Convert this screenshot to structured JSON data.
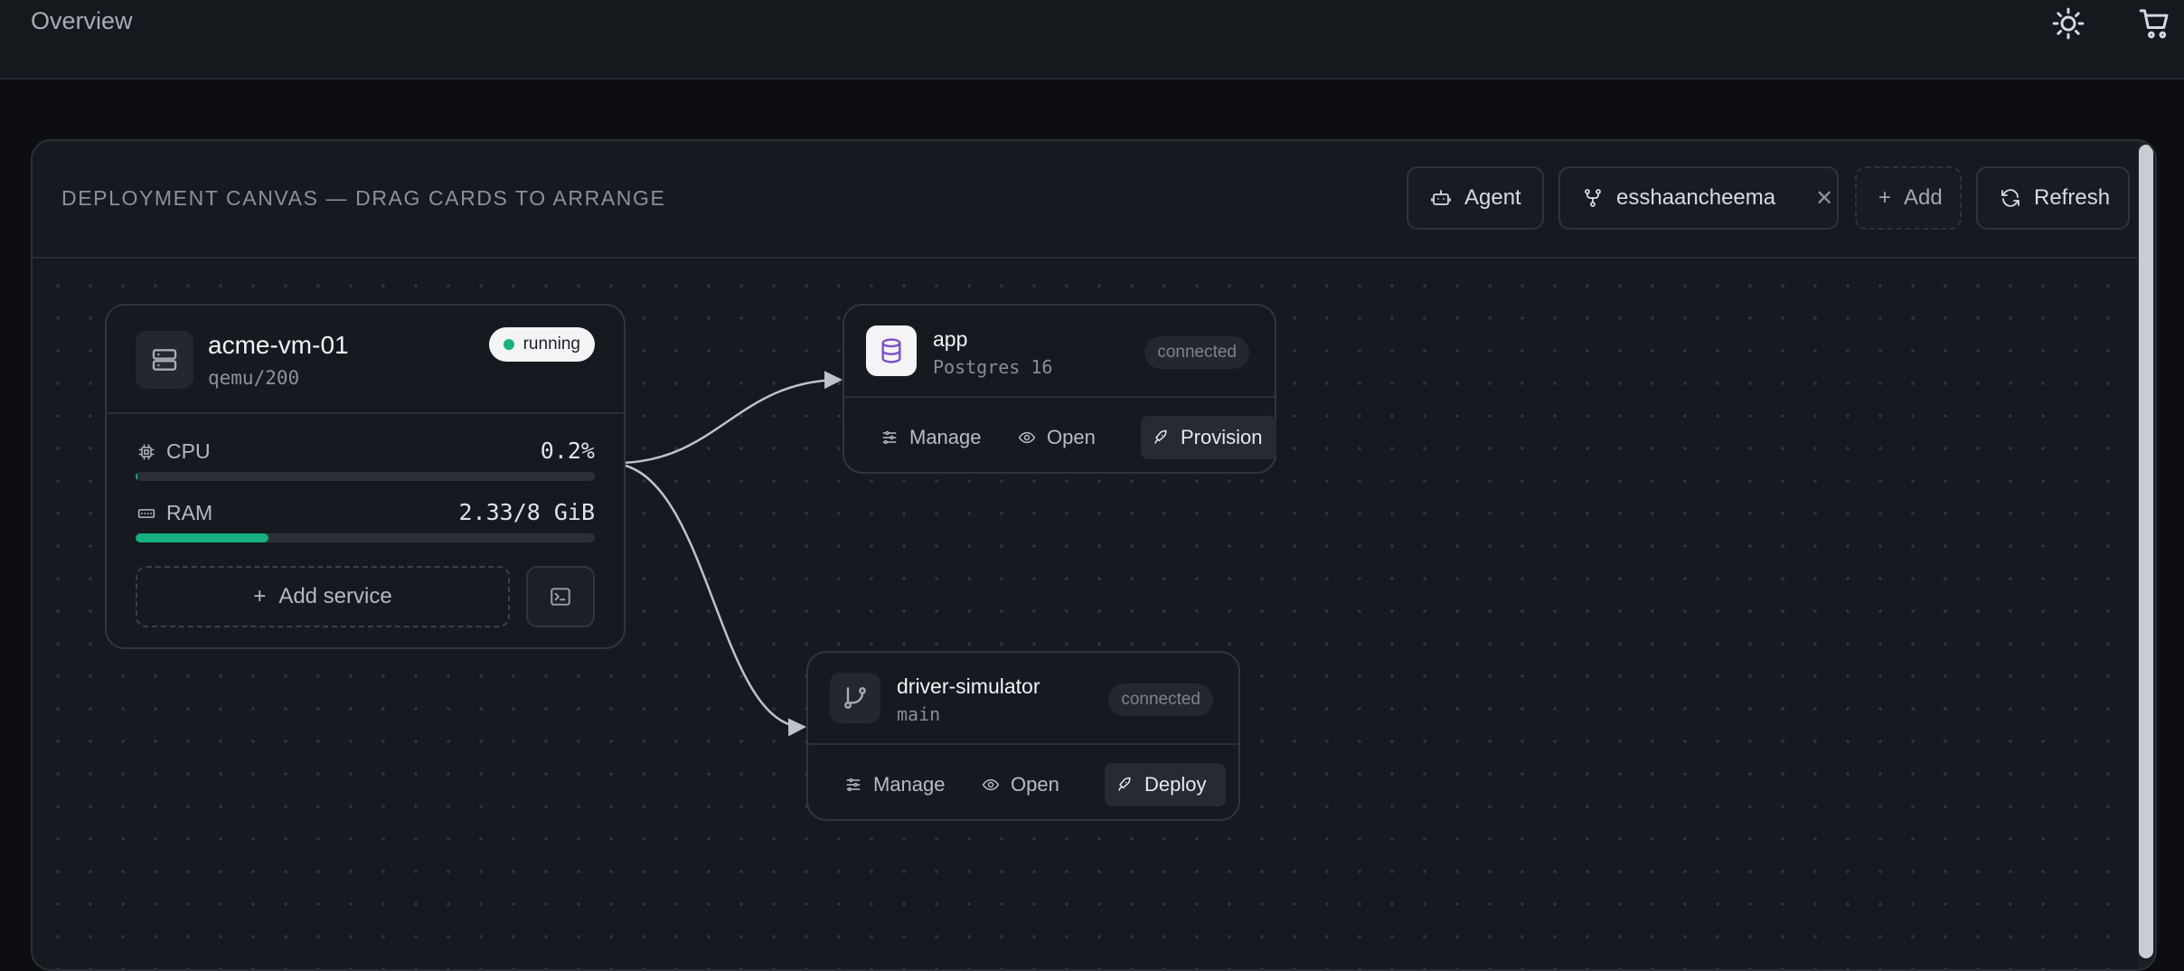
{
  "header": {
    "title": "Overview",
    "theme_icon": "sun-icon",
    "cart_icon": "cart-icon"
  },
  "panel": {
    "title": "DEPLOYMENT CANVAS — DRAG CARDS TO ARRANGE",
    "agent_label": "Agent",
    "user_chip": "esshaancheema",
    "add_label": "Add",
    "refresh_label": "Refresh"
  },
  "vm": {
    "name": "acme-vm-01",
    "subtitle": "qemu/200",
    "status": "running",
    "cpu_label": "CPU",
    "cpu_value": "0.2%",
    "cpu_fraction": 0.002,
    "ram_label": "RAM",
    "ram_value": "2.33/8 GiB",
    "ram_fraction": 0.29,
    "add_service_label": "Add service"
  },
  "services": [
    {
      "name": "app",
      "subtitle": "Postgres 16",
      "status": "connected",
      "icon": "database-icon",
      "actions": {
        "manage": "Manage",
        "open": "Open",
        "primary": "Provision"
      }
    },
    {
      "name": "driver-simulator",
      "subtitle": "main",
      "status": "connected",
      "icon": "git-branch-icon",
      "actions": {
        "manage": "Manage",
        "open": "Open",
        "primary": "Deploy"
      }
    }
  ],
  "colors": {
    "accent_green": "#14b07e",
    "database_icon": "#7c4dcc"
  }
}
